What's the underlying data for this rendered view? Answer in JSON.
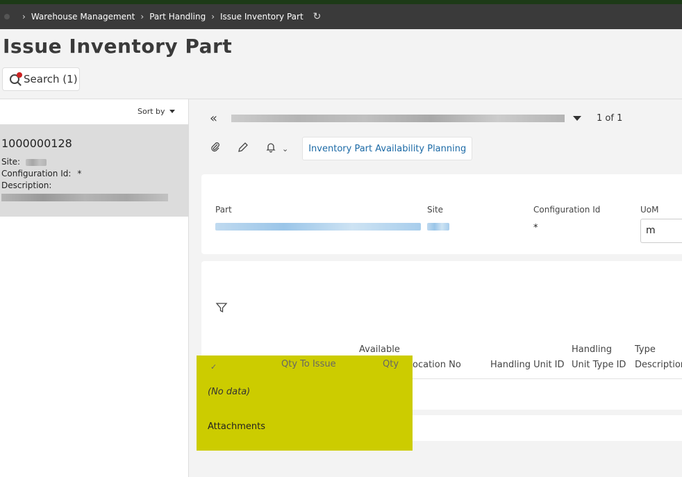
{
  "breadcrumb": {
    "items": [
      "Warehouse Management",
      "Part Handling",
      "Issue Inventory Part"
    ]
  },
  "page": {
    "title": "Issue Inventory Part"
  },
  "search": {
    "label": "Search (1)"
  },
  "list": {
    "sort_label": "Sort by",
    "record": {
      "id": "1000000128",
      "site_label": "Site:",
      "config_label": "Configuration Id:",
      "config_value": "*",
      "description_label": "Description:"
    }
  },
  "navigator": {
    "count": "1 of 1"
  },
  "toolbar": {
    "command": "Inventory Part Availability Planning"
  },
  "header": {
    "part_label": "Part",
    "site_label": "Site",
    "config_label": "Configuration Id",
    "config_value": "*",
    "uom_label": "UoM",
    "uom_value": "m"
  },
  "grid": {
    "columns": {
      "qty_to_issue": "Qty To Issue",
      "available_qty_line1": "Available",
      "available_qty_line2": "Qty",
      "location_no": "Location No",
      "handling_unit_id": "Handling Unit ID",
      "handling_unit_type_line1": "Handling",
      "handling_unit_type_line2": "Unit Type ID",
      "type_desc_line1": "Type",
      "type_desc_line2": "Description"
    },
    "empty_text": "(No data)"
  },
  "attachments": {
    "label": "Attachments"
  },
  "colors": {
    "breadcrumb_bg": "#3a3a3a",
    "highlight": "#cccc00",
    "link_blue": "#1c6aa6"
  }
}
